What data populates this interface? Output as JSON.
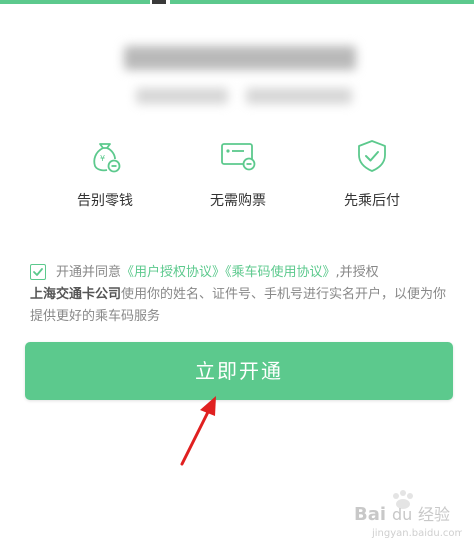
{
  "features": [
    {
      "icon": "money-bag-yuan-icon",
      "label": "告别零钱"
    },
    {
      "icon": "card-minus-icon",
      "label": "无需购票"
    },
    {
      "icon": "shield-check-icon",
      "label": "先乘后付"
    }
  ],
  "agreement": {
    "prefix": "开通并同意",
    "link1": "《用户授权协议》",
    "link2": "《乘车码使用协议》",
    "mid": ",并授权",
    "company": "上海交通卡公司",
    "suffix": "使用你的姓名、证件号、手机号进行实名开户，以便为你提供更好的乘车码服务",
    "checked": true
  },
  "button": {
    "label": "立即开通"
  },
  "colors": {
    "accent": "#5cc98d",
    "arrow": "#e02020"
  },
  "watermark": {
    "brand": "Baidu 经验",
    "url": "jingyan.baidu.com"
  }
}
